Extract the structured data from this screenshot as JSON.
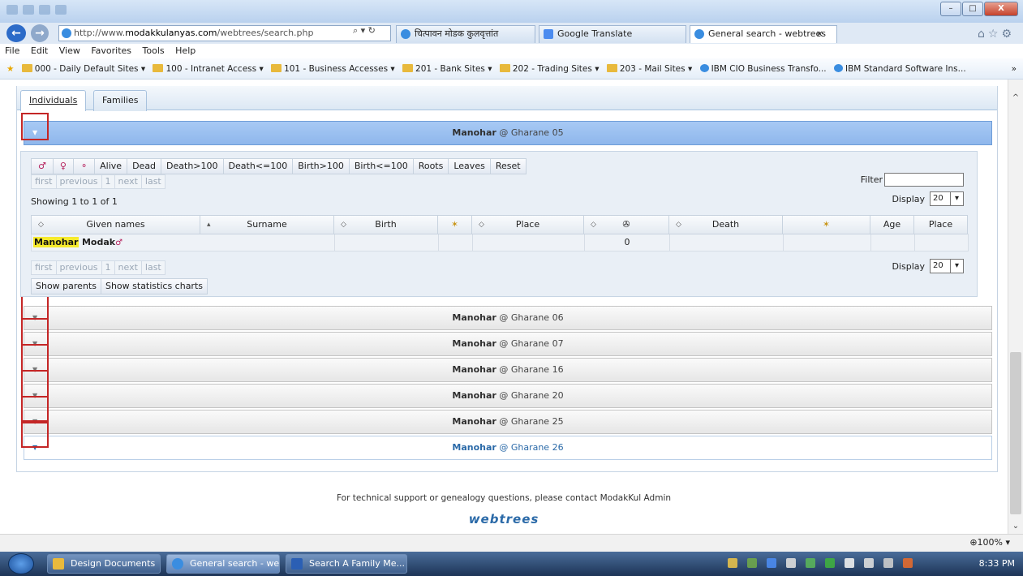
{
  "window": {
    "min_label": "–",
    "max_label": "□",
    "close_label": "X"
  },
  "browser": {
    "url_prefix": "http://www.",
    "url_domain": "modakkulanyas.com",
    "url_path": "/webtrees/search.php",
    "addr_tools": "⌕ ▾ ↻",
    "tabs": [
      {
        "label": "चित्पावन मोडक कुलवृत्तांत"
      },
      {
        "label": "Google Translate"
      },
      {
        "label": "General search - webtrees"
      }
    ],
    "tab_close": "×",
    "right_icons": "⌂☆⚙"
  },
  "menubar": [
    "File",
    "Edit",
    "View",
    "Favorites",
    "Tools",
    "Help"
  ],
  "favorites": [
    "000 - Daily Default Sites ▾",
    "100 - Intranet Access ▾",
    "101 - Business Accesses ▾",
    "201 - Bank Sites ▾",
    "202 - Trading Sites ▾",
    "203 - Mail Sites ▾",
    "IBM CIO Business Transfo...",
    "IBM Standard Software Ins..."
  ],
  "favorites_more": "»",
  "page": {
    "tabs": [
      "Individuals",
      "Families"
    ],
    "open_section": {
      "name": "Manohar",
      "place": "@ Gharane 05"
    },
    "filters": [
      "♂",
      "♀",
      "⚬",
      "Alive",
      "Dead",
      "Death>100",
      "Death<=100",
      "Birth>100",
      "Birth<=100",
      "Roots",
      "Leaves",
      "Reset"
    ],
    "pager": [
      "first",
      "previous",
      "1",
      "next",
      "last"
    ],
    "showing": "Showing 1 to 1 of 1",
    "filter_label": "Filter",
    "display_label": "Display",
    "display_value": "20",
    "columns": [
      {
        "label": "Given names",
        "sort": "◇"
      },
      {
        "label": "Surname",
        "sort": "▴"
      },
      {
        "label": "Birth",
        "sort": "◇"
      },
      {
        "label": "✶",
        "sort": ""
      },
      {
        "label": "Place",
        "sort": "◇"
      },
      {
        "label": "✇",
        "sort": "◇"
      },
      {
        "label": "Death",
        "sort": "◇"
      },
      {
        "label": "✶",
        "sort": ""
      },
      {
        "label": "Age",
        "sort": ""
      },
      {
        "label": "Place",
        "sort": ""
      }
    ],
    "row": {
      "given": "Manohar",
      "surname": "Modak",
      "sex_symbol": "♂",
      "count": "0"
    },
    "bottom_buttons": [
      "Show parents",
      "Show statistics charts"
    ],
    "sections": [
      {
        "name": "Manohar",
        "place": "@ Gharane 06"
      },
      {
        "name": "Manohar",
        "place": "@ Gharane 07"
      },
      {
        "name": "Manohar",
        "place": "@ Gharane 16"
      },
      {
        "name": "Manohar",
        "place": "@ Gharane 20"
      },
      {
        "name": "Manohar",
        "place": "@ Gharane 25"
      },
      {
        "name": "Manohar",
        "place": "@ Gharane 26"
      }
    ],
    "footer": "For technical support or genealogy questions, please contact ModakKul Admin",
    "logo": "webtrees"
  },
  "statusbar": {
    "zoom": "⊕100%  ▾"
  },
  "taskbar": {
    "buttons": [
      "Design Documents",
      "General search - web...",
      "Search A Family Me..."
    ],
    "clock": "8:33 PM"
  },
  "colors": {
    "accent": "#2b6aa8",
    "open_header": "#8fb7ec",
    "highlight": "#f6ea2c",
    "red_box": "#c42626"
  }
}
